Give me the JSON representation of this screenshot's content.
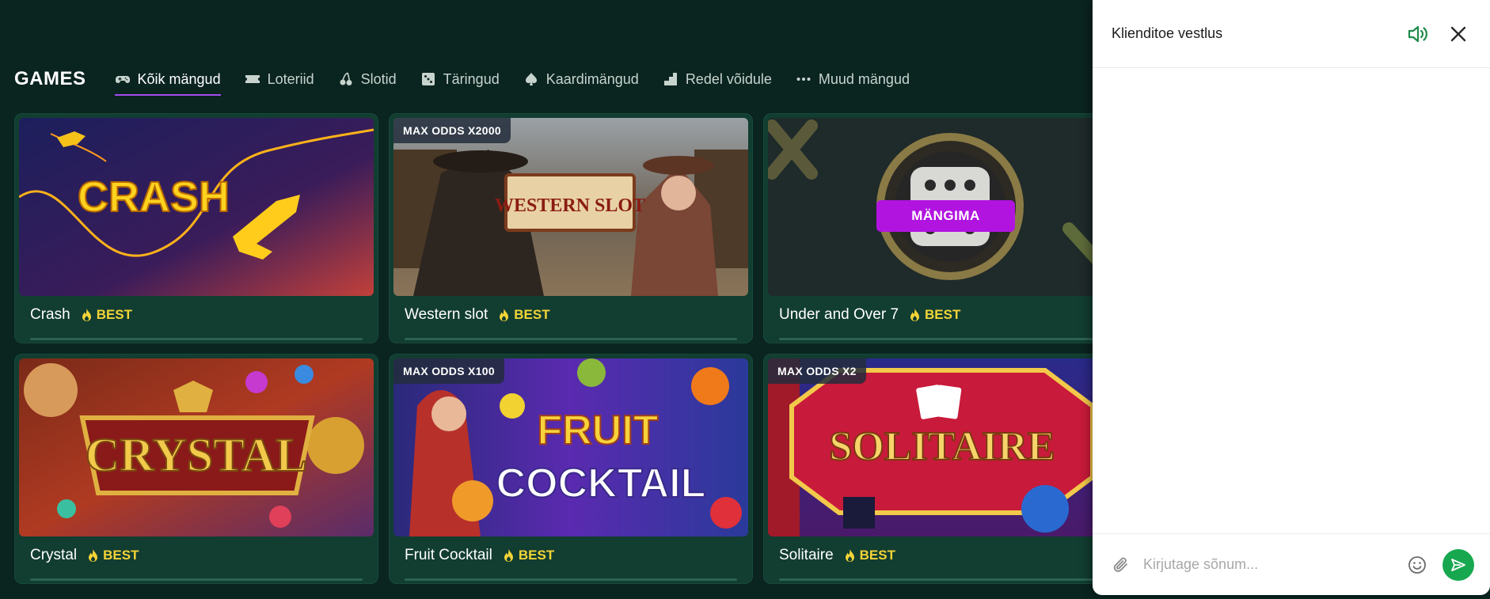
{
  "games": {
    "title": "GAMES",
    "tabs": [
      {
        "label": "Kõik mängud",
        "icon": "gamepad-icon",
        "active": true
      },
      {
        "label": "Loteriid",
        "icon": "ticket-icon"
      },
      {
        "label": "Slotid",
        "icon": "cherries-icon"
      },
      {
        "label": "Täringud",
        "icon": "dice-icon"
      },
      {
        "label": "Kaardimängud",
        "icon": "spade-icon"
      },
      {
        "label": "Redel võidule",
        "icon": "ladder-icon"
      },
      {
        "label": "Muud mängud",
        "icon": "more-dots-icon"
      }
    ],
    "cards": [
      {
        "title": "Crash",
        "badge": "BEST",
        "art_text": "CRASH"
      },
      {
        "title": "Western slot",
        "badge": "BEST",
        "odds": "MAX ODDS X2000",
        "art_text": "WESTERN SLOT"
      },
      {
        "title": "Under and Over 7",
        "badge": "BEST",
        "play_label": "MÄNGIMA"
      },
      {
        "title": "Crystal",
        "badge": "BEST",
        "art_text": "CRYSTAL"
      },
      {
        "title": "Fruit Cocktail",
        "badge": "BEST",
        "odds": "MAX ODDS X100",
        "art_text_1": "FRUIT",
        "art_text_2": "COCKTAIL"
      },
      {
        "title": "Solitaire",
        "badge": "BEST",
        "odds": "MAX ODDS X2",
        "art_text": "SOLITAIRE"
      }
    ]
  },
  "chat": {
    "title": "Klienditoe vestlus",
    "input_placeholder": "Kirjutage sõnum...",
    "colors": {
      "send": "#17a84f",
      "sound": "#1f8a4c"
    }
  },
  "colors": {
    "background": "#0a2420",
    "card": "#123d31",
    "accent_purple": "#a64df2",
    "play": "#b114df",
    "best": "#f3d437"
  }
}
